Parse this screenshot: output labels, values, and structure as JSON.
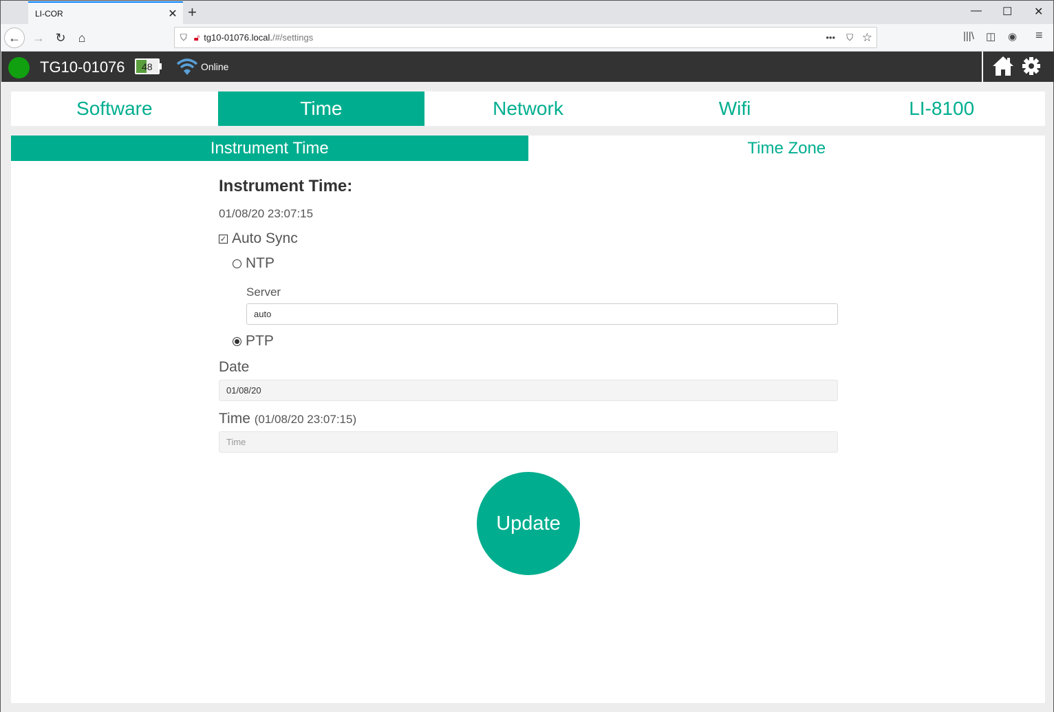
{
  "browser": {
    "tab_title": "LI-COR",
    "url_host": "tg10-01076.local.",
    "url_path": "/#/settings"
  },
  "header": {
    "device_name": "TG10-01076",
    "status_color": "#10a010",
    "battery_level": 48,
    "battery_label": "48",
    "network_status": "Online"
  },
  "main_tabs": [
    {
      "label": "Software",
      "active": false
    },
    {
      "label": "Time",
      "active": true
    },
    {
      "label": "Network",
      "active": false
    },
    {
      "label": "Wifi",
      "active": false
    },
    {
      "label": "LI-8100",
      "active": false
    }
  ],
  "sub_tabs": [
    {
      "label": "Instrument Time",
      "active": true
    },
    {
      "label": "Time Zone",
      "active": false
    }
  ],
  "form": {
    "heading": "Instrument Time:",
    "current_time": "01/08/20 23:07:15",
    "auto_sync_label": "Auto Sync",
    "auto_sync_checked": true,
    "ntp_label": "NTP",
    "ptp_label": "PTP",
    "selected_protocol": "PTP",
    "server_label": "Server",
    "server_value": "auto",
    "date_label": "Date",
    "date_value": "01/08/20",
    "time_label": "Time",
    "time_note": "(01/08/20 23:07:15)",
    "time_placeholder": "Time",
    "update_label": "Update"
  },
  "colors": {
    "accent": "#00ae8f",
    "header_bg": "#333333"
  }
}
